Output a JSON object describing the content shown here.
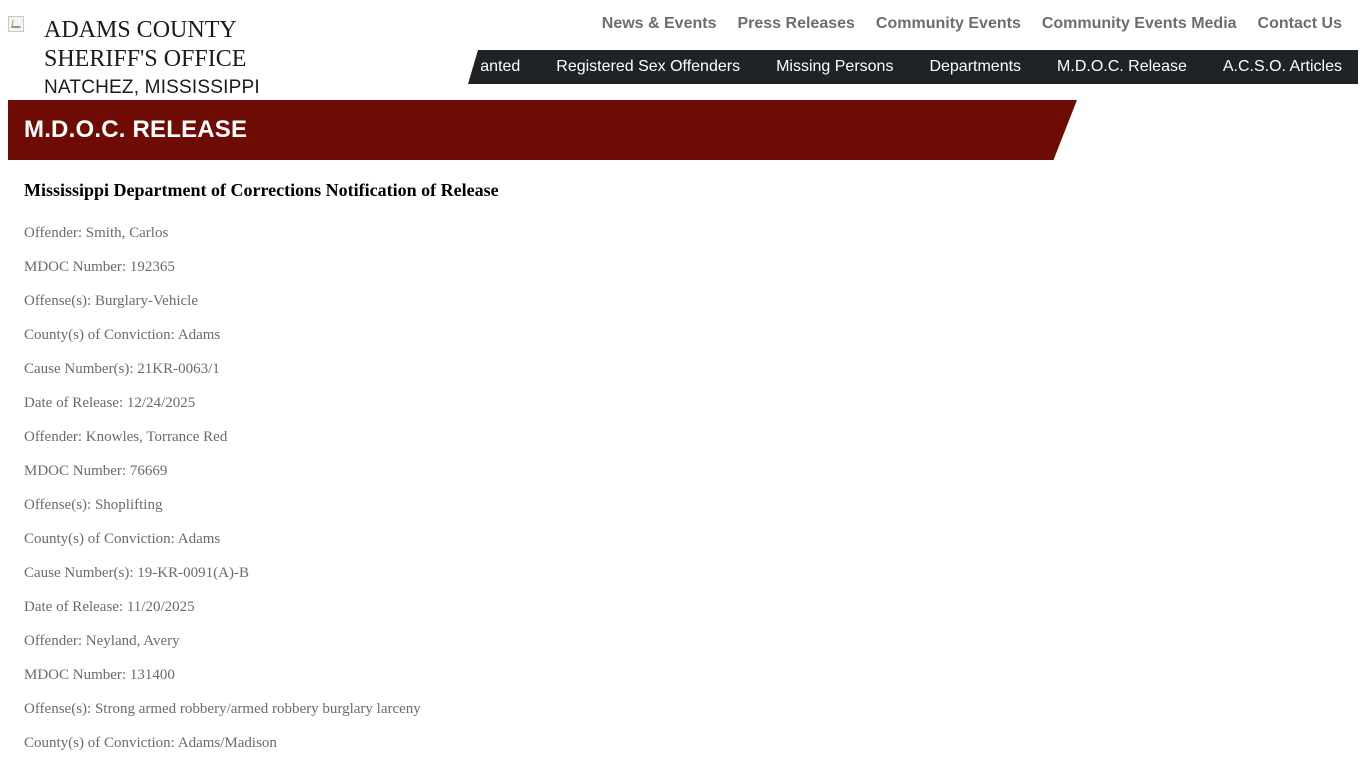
{
  "header": {
    "brand_line1": "ADAMS COUNTY",
    "brand_line2": "SHERIFF'S OFFICE",
    "brand_line3": "NATCHEZ, MISSISSIPPI",
    "top_nav": [
      "News & Events",
      "Press Releases",
      "Community Events",
      "Community Events Media",
      "Contact Us"
    ],
    "main_nav": [
      "anted",
      "Registered Sex Offenders",
      "Missing Persons",
      "Departments",
      "M.D.O.C. Release",
      "A.C.S.O. Articles"
    ]
  },
  "banner": {
    "title": "M.D.O.C. RELEASE"
  },
  "content": {
    "heading": "Mississippi Department of Corrections Notification of Release",
    "lines": [
      "Offender: Smith, Carlos",
      "MDOC Number: 192365",
      "Offense(s): Burglary-Vehicle",
      "County(s) of Conviction: Adams",
      "Cause Number(s): 21KR-0063/1",
      "Date of Release: 12/24/2025",
      "Offender: Knowles, Torrance Red",
      "MDOC Number: 76669",
      "Offense(s): Shoplifting",
      "County(s) of Conviction: Adams",
      "Cause Number(s): 19-KR-0091(A)-B",
      "Date of Release: 11/20/2025",
      "Offender: Neyland, Avery",
      "MDOC Number: 131400",
      "Offense(s): Strong armed robbery/armed robbery burglary larceny",
      "County(s) of Conviction: Adams/Madison"
    ]
  },
  "colors": {
    "banner": "#6e0b05",
    "nav_bg": "#1f2326",
    "top_nav_text": "#6d6d6d",
    "body_text": "#6b6b6b"
  }
}
